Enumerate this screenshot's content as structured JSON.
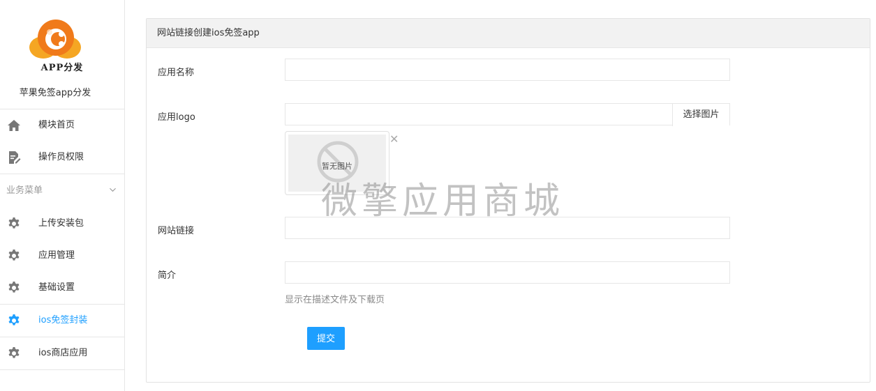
{
  "sidebar": {
    "logo_text": "APP分发",
    "subtitle": "苹果免签app分发",
    "top_items": [
      {
        "label": "模块首页",
        "icon": "home-icon"
      },
      {
        "label": "操作员权限",
        "icon": "document-edit-icon"
      }
    ],
    "group": {
      "title": "业务菜单",
      "items": [
        {
          "label": "上传安装包",
          "icon": "gear-icon",
          "active": false
        },
        {
          "label": "应用管理",
          "icon": "gear-icon",
          "active": false
        },
        {
          "label": "基础设置",
          "icon": "gear-icon",
          "active": false
        },
        {
          "label": "ios免签封装",
          "icon": "gear-icon",
          "active": true
        },
        {
          "label": "ios商店应用",
          "icon": "gear-icon",
          "active": false
        }
      ]
    }
  },
  "main": {
    "title": "网站链接创建ios免签app",
    "fields": {
      "app_name": {
        "label": "应用名称",
        "value": ""
      },
      "app_logo": {
        "label": "应用logo",
        "value": "",
        "button": "选择图片",
        "no_image": "暂无图片"
      },
      "site_link": {
        "label": "网站链接",
        "value": ""
      },
      "intro": {
        "label": "简介",
        "value": "",
        "hint": "显示在描述文件及下载页"
      }
    },
    "submit_label": "提交"
  },
  "watermark": "微擎应用商城",
  "colors": {
    "accent": "#1e9fff",
    "gear": "#777777",
    "logo_orange": "#f07a1a"
  }
}
